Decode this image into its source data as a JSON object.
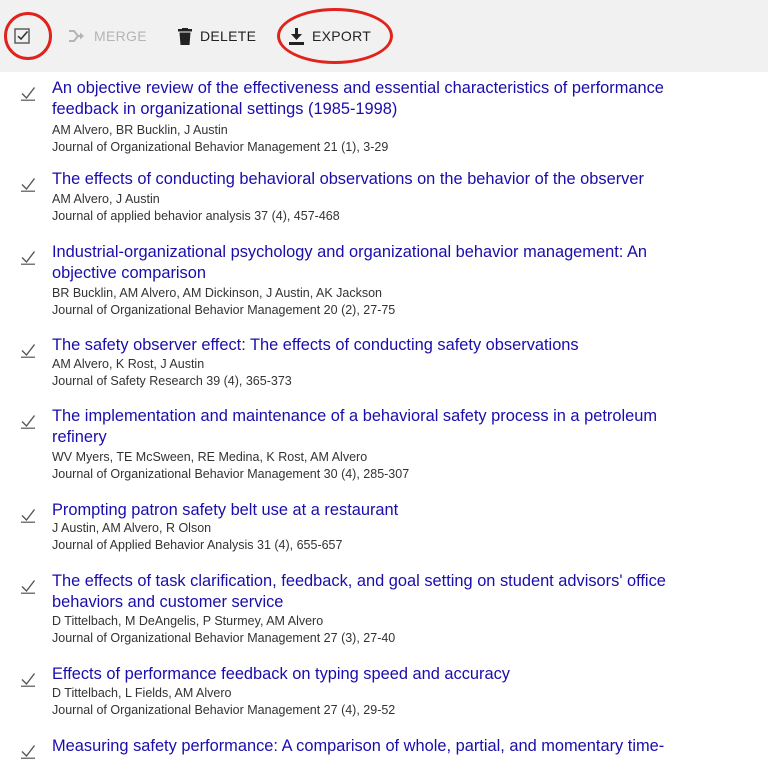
{
  "toolbar": {
    "merge_label": "MERGE",
    "delete_label": "DELETE",
    "export_label": "EXPORT"
  },
  "articles": [
    {
      "title_line1": "An objective review of the effectiveness and essential characteristics of performance",
      "title_line2": "feedback in organizational settings (1985-1998)",
      "authors": "AM Alvero, BR Bucklin, J Austin",
      "source": "Journal of Organizational Behavior Management 21 (1), 3-29",
      "checked": true
    },
    {
      "title_line1": "The effects of conducting behavioral observations on the behavior of the observer",
      "title_line2": "",
      "authors": "AM Alvero, J Austin",
      "source": "Journal of applied behavior analysis 37 (4), 457-468",
      "checked": true
    },
    {
      "title_line1": "Industrial-organizational psychology and organizational behavior management: An",
      "title_line2": "objective comparison",
      "authors": "BR Bucklin, AM Alvero, AM Dickinson, J Austin, AK Jackson",
      "source": "Journal of Organizational Behavior Management 20 (2), 27-75",
      "checked": true
    },
    {
      "title_line1": "The safety observer effect: The effects of conducting safety observations",
      "title_line2": "",
      "authors": "AM Alvero, K Rost, J Austin",
      "source": "Journal of Safety Research 39 (4), 365-373",
      "checked": true
    },
    {
      "title_line1": "The implementation and maintenance of a behavioral safety process in a petroleum",
      "title_line2": "refinery",
      "authors": "WV Myers, TE McSween, RE Medina, K Rost, AM Alvero",
      "source": "Journal of Organizational Behavior Management 30 (4), 285-307",
      "checked": true
    },
    {
      "title_line1": "Prompting patron safety belt use at a restaurant",
      "title_line2": "",
      "authors": "J Austin, AM Alvero, R Olson",
      "source": "Journal of Applied Behavior Analysis 31 (4), 655-657",
      "checked": true
    },
    {
      "title_line1": "The effects of task clarification, feedback, and goal setting on student advisors' office",
      "title_line2": "behaviors and customer service",
      "authors": "D Tittelbach, M DeAngelis, P Sturmey, AM Alvero",
      "source": "Journal of Organizational Behavior Management 27 (3), 27-40",
      "checked": true
    },
    {
      "title_line1": "Effects of performance feedback on typing speed and accuracy",
      "title_line2": "",
      "authors": "D Tittelbach, L Fields, AM Alvero",
      "source": "Journal of Organizational Behavior Management 27 (4), 29-52",
      "checked": true
    },
    {
      "title_line1": "Measuring safety performance: A comparison of whole, partial, and momentary time-",
      "title_line2": "",
      "authors": "",
      "source": "",
      "checked": true
    }
  ],
  "colors": {
    "link": "#1a0dab",
    "toolbar_bg": "#f1f1f1",
    "highlight": "#e0231c"
  },
  "icons": {
    "select_all": "checkbox-checked-icon",
    "merge": "merge-arrow-icon",
    "delete": "trash-icon",
    "export": "download-icon"
  }
}
